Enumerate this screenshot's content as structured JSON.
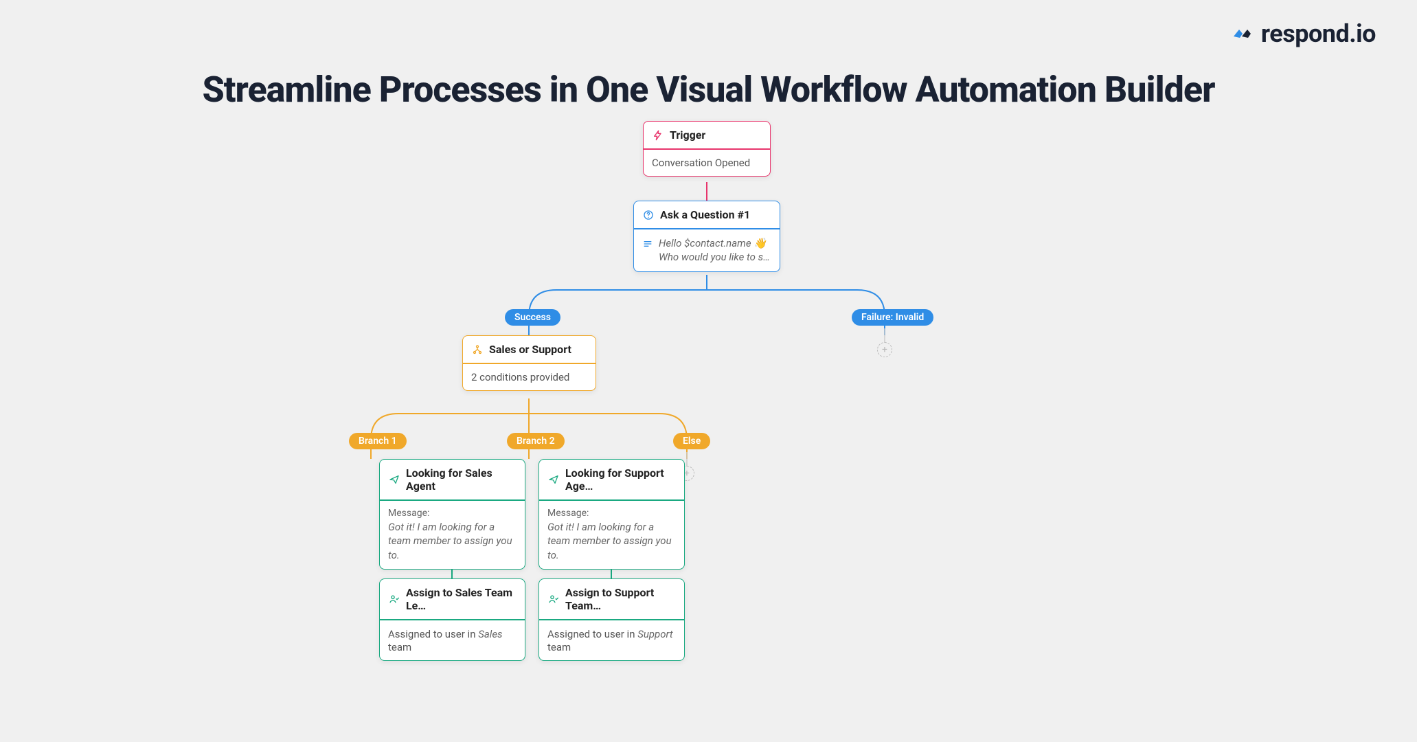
{
  "brand": "respond.io",
  "title": "Streamline Processes in One Visual Workflow Automation Builder",
  "nodes": {
    "trigger": {
      "label": "Trigger",
      "subtitle": "Conversation Opened",
      "icon": "bolt-icon",
      "accent": "#e8356c"
    },
    "ask": {
      "label": "Ask a Question #1",
      "line1": "Hello $contact.name 👋",
      "line2": "Who would you like to s…",
      "icon": "help-circle-icon",
      "accent": "#2f8de6"
    },
    "outcomes": {
      "success": "Success",
      "failure": "Failure: Invalid"
    },
    "branch": {
      "label": "Sales or Support",
      "subtitle": "2 conditions provided",
      "icon": "branch-icon",
      "accent": "#f0a82a"
    },
    "branch_labels": {
      "b1": "Branch 1",
      "b2": "Branch 2",
      "else": "Else"
    },
    "send_sales": {
      "label": "Looking for Sales Agent",
      "msg_label": "Message:",
      "msg": "Got it! I am looking for a team member to assign you to.",
      "icon": "send-icon",
      "accent": "#1aa981"
    },
    "send_support": {
      "label": "Looking for Support Age…",
      "msg_label": "Message:",
      "msg": "Got it! I am looking for a team member to assign you to.",
      "icon": "send-icon",
      "accent": "#1aa981"
    },
    "assign_sales": {
      "label": "Assign to Sales Team Le…",
      "body_pre": "Assigned to user in ",
      "body_team": "Sales",
      "body_post": " team",
      "icon": "user-check-icon",
      "accent": "#1aa981"
    },
    "assign_support": {
      "label": "Assign to Support Team…",
      "body_pre": "Assigned to user in ",
      "body_team": "Support",
      "body_post": " team",
      "icon": "user-check-icon",
      "accent": "#1aa981"
    }
  }
}
